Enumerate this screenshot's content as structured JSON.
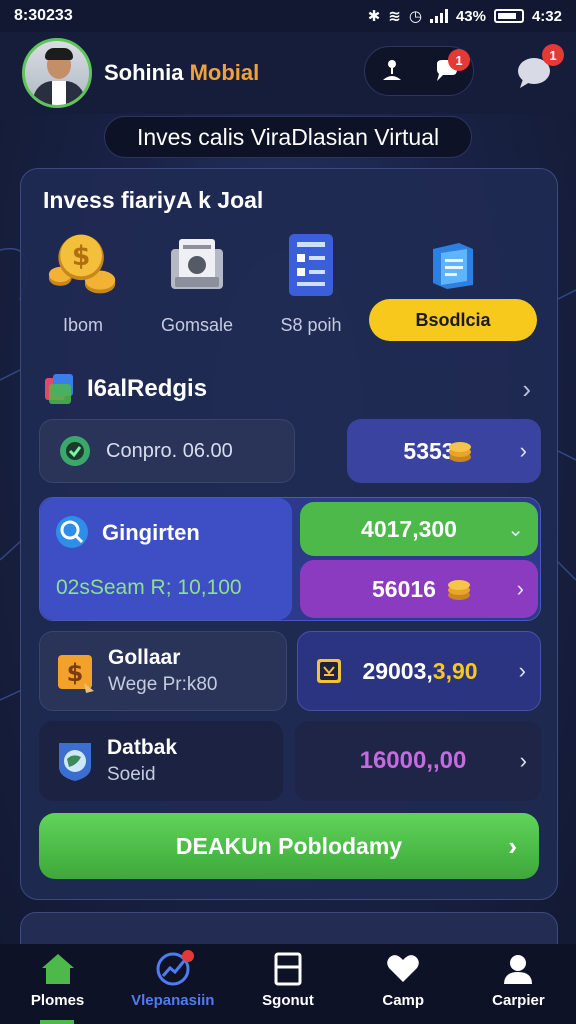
{
  "status_bar": {
    "time": "8:30233",
    "battery_pct": "43%",
    "right_time": "4:32"
  },
  "header": {
    "brand_main": "Sohinia ",
    "brand_accent": "Mobial",
    "notif_count": "1",
    "chat_count": "1"
  },
  "subtitle": "Inves calis ViraDlasian Virtual",
  "card_title": "Invess fiariyA k Joal",
  "quick_actions": [
    {
      "label": "Ibom",
      "icon": "gold-coins-icon"
    },
    {
      "label": "Gomsale",
      "icon": "document-box-icon"
    },
    {
      "label": "S8 poih",
      "icon": "blue-form-icon"
    },
    {
      "label": "Bsodlcia",
      "icon": "book-icon",
      "active": true
    }
  ],
  "section": {
    "title": "I6alRedgis"
  },
  "rows": {
    "r1": {
      "left_label": "Conpro. 06.00",
      "right_value": "5353"
    },
    "r2": {
      "left_title": "Gingirten",
      "left_sub": "02sSeam R; 10,100",
      "green_value": "4017,300",
      "purple_value": "56016"
    },
    "r3": {
      "left_title": "Gollaar",
      "left_sub": "Wege Pr:k80",
      "right_value_a": "29003,",
      "right_value_b": "3,90"
    },
    "r4": {
      "left_title": "Datbak",
      "left_sub": "Soeid",
      "right_value": "16000,,00"
    }
  },
  "cta": {
    "label": "DEAKUn Poblodamy"
  },
  "bottom_nav": [
    {
      "label": "Plomes",
      "icon": "home-icon",
      "active": false
    },
    {
      "label": "Vlepanasiin",
      "icon": "chart-circle-icon",
      "active": true
    },
    {
      "label": "Sgonut",
      "icon": "document-icon",
      "active": false
    },
    {
      "label": "Camp",
      "icon": "heart-chat-icon",
      "active": false
    },
    {
      "label": "Carpier",
      "icon": "profile-icon",
      "active": false
    }
  ],
  "colors": {
    "accent_green": "#4cb94a",
    "accent_yellow": "#f7c91d",
    "accent_purple": "#8a3bc0",
    "accent_blue": "#3a44a0",
    "brand_orange": "#f0a23a",
    "nav_active": "#4f7cf3"
  }
}
